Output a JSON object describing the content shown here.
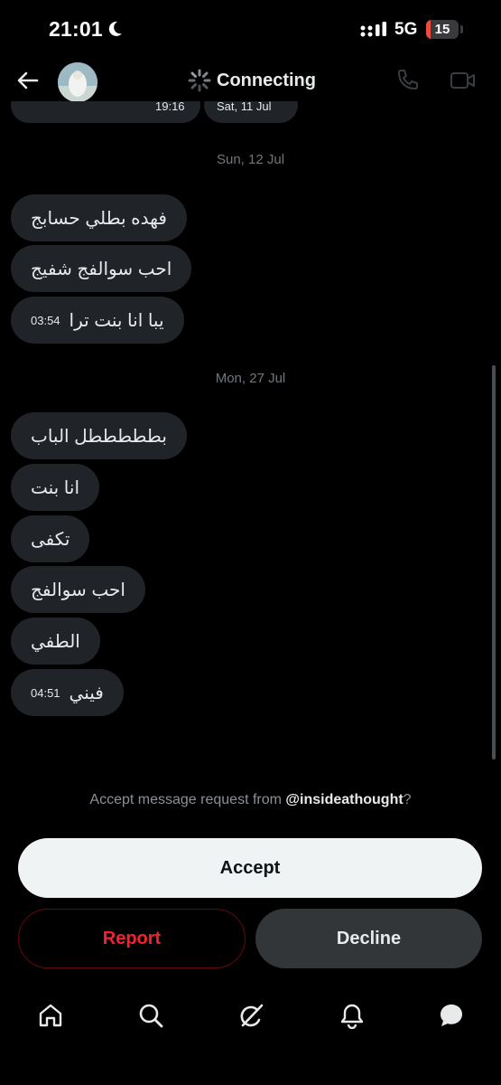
{
  "status": {
    "time": "21:01",
    "network": "5G",
    "battery": "15",
    "battery_level": 0.15
  },
  "header": {
    "title": "Connecting"
  },
  "conversation": {
    "partial_timestamp": "19:16",
    "partial_date": "Sat, 11 Jul",
    "groups": [
      {
        "date": "Sun, 12 Jul",
        "messages": [
          {
            "text": "فهده بطلي حسابج",
            "time": ""
          },
          {
            "text": "احب سوالفج شفيج",
            "time": ""
          },
          {
            "text": "يبا انا بنت ترا",
            "time": "03:54"
          }
        ]
      },
      {
        "date": "Mon, 27 Jul",
        "messages": [
          {
            "text": "بطططططل الباب",
            "time": ""
          },
          {
            "text": "انا بنت",
            "time": ""
          },
          {
            "text": "تكفى",
            "time": ""
          },
          {
            "text": "احب سوالفج",
            "time": ""
          },
          {
            "text": "الطفي",
            "time": ""
          },
          {
            "text": "فيني",
            "time": "04:51"
          }
        ]
      }
    ]
  },
  "request": {
    "prefix": "Accept message request from ",
    "handle": "@insideathought",
    "suffix": "?",
    "accept_label": "Accept",
    "report_label": "Report",
    "decline_label": "Decline"
  },
  "nav": [
    "home-icon",
    "search-icon",
    "grok-icon",
    "notifications-icon",
    "messages-icon"
  ],
  "colors": {
    "background": "#000000",
    "bubble": "#202327",
    "accent_red": "#f4212e",
    "muted": "#71767b"
  }
}
